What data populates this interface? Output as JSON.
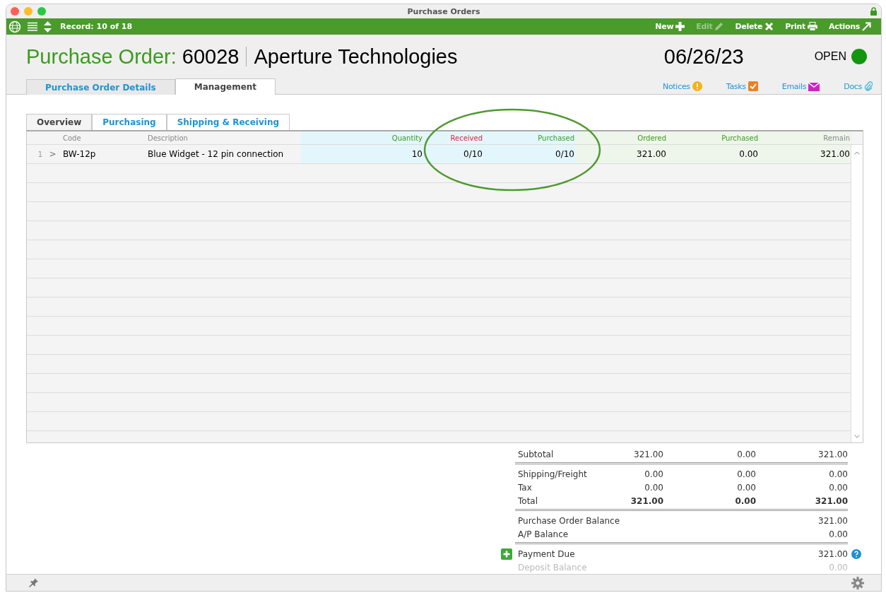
{
  "window": {
    "title": "Purchase Orders"
  },
  "toolbar": {
    "record": "Record: 10 of 18",
    "actions": [
      {
        "label": "New",
        "kind": "new",
        "disabled": false
      },
      {
        "label": "Edit",
        "kind": "edit",
        "disabled": true
      },
      {
        "label": "Delete",
        "kind": "delete",
        "disabled": false
      },
      {
        "label": "Print",
        "kind": "print",
        "disabled": false
      },
      {
        "label": "Actions",
        "kind": "actions",
        "disabled": false
      }
    ]
  },
  "header": {
    "title_label": "Purchase Order:",
    "number": "60028",
    "vendor": "Aperture Technologies",
    "date": "06/26/23",
    "status": {
      "label": "OPEN",
      "color": "#13960f"
    }
  },
  "main_tabs": [
    {
      "label": "Purchase Order Details",
      "selected": false
    },
    {
      "label": "Management",
      "selected": true
    }
  ],
  "links": [
    {
      "label": "Notices",
      "kind": "notices"
    },
    {
      "label": "Tasks",
      "kind": "tasks"
    },
    {
      "label": "Emails",
      "kind": "emails"
    },
    {
      "label": "Docs",
      "kind": "docs"
    }
  ],
  "sub_tabs": [
    {
      "label": "Overview",
      "selected": true
    },
    {
      "label": "Purchasing",
      "selected": false
    },
    {
      "label": "Shipping & Receiving",
      "selected": false
    }
  ],
  "table": {
    "columns": [
      {
        "label": "Code",
        "color": "#888888",
        "kind": "plain"
      },
      {
        "label": "Description",
        "color": "#888888",
        "kind": "plain"
      },
      {
        "label": "Quantity",
        "color": "#3c9a1e",
        "kind": "quantity"
      },
      {
        "label": "Received",
        "color": "#d9263a",
        "kind": "quantity"
      },
      {
        "label": "Purchased",
        "color": "#3c9a1e",
        "kind": "quantity"
      },
      {
        "label": "Ordered",
        "color": "#3c9a1e",
        "kind": "amount"
      },
      {
        "label": "Purchased",
        "color": "#3c9a1e",
        "kind": "amount"
      },
      {
        "label": "Remain",
        "color": "#888888",
        "kind": "amount"
      }
    ],
    "rows": [
      {
        "number": "1",
        "expander": ">",
        "cells": [
          "BW-12p",
          "Blue Widget - 12 pin connection",
          "10",
          "0/10",
          "0/10",
          "321.00",
          "0.00",
          "321.00"
        ]
      }
    ]
  },
  "totals": [
    {
      "label": "Subtotal",
      "values": [
        "321.00",
        "0.00",
        "321.00"
      ],
      "kind": "normal",
      "rule_below": true
    },
    {
      "label": "Shipping/Freight",
      "values": [
        "0.00",
        "0.00",
        "0.00"
      ],
      "kind": "normal",
      "rule_below": false
    },
    {
      "label": "Tax",
      "values": [
        "0.00",
        "0.00",
        "0.00"
      ],
      "kind": "normal",
      "rule_below": false
    },
    {
      "label": "Total",
      "values": [
        "321.00",
        "0.00",
        "321.00"
      ],
      "kind": "bold",
      "rule_below": true
    },
    {
      "label": "Purchase Order Balance",
      "values": [
        "321.00"
      ],
      "kind": "normal",
      "rule_below": false
    },
    {
      "label": "A/P Balance",
      "values": [
        "0.00"
      ],
      "kind": "normal",
      "rule_below": true
    },
    {
      "label": "Payment Due",
      "values": [
        "321.00"
      ],
      "kind": "payment",
      "rule_below": false
    },
    {
      "label": "Deposit Balance",
      "values": [
        "0.00"
      ],
      "kind": "muted",
      "rule_below": false
    }
  ]
}
